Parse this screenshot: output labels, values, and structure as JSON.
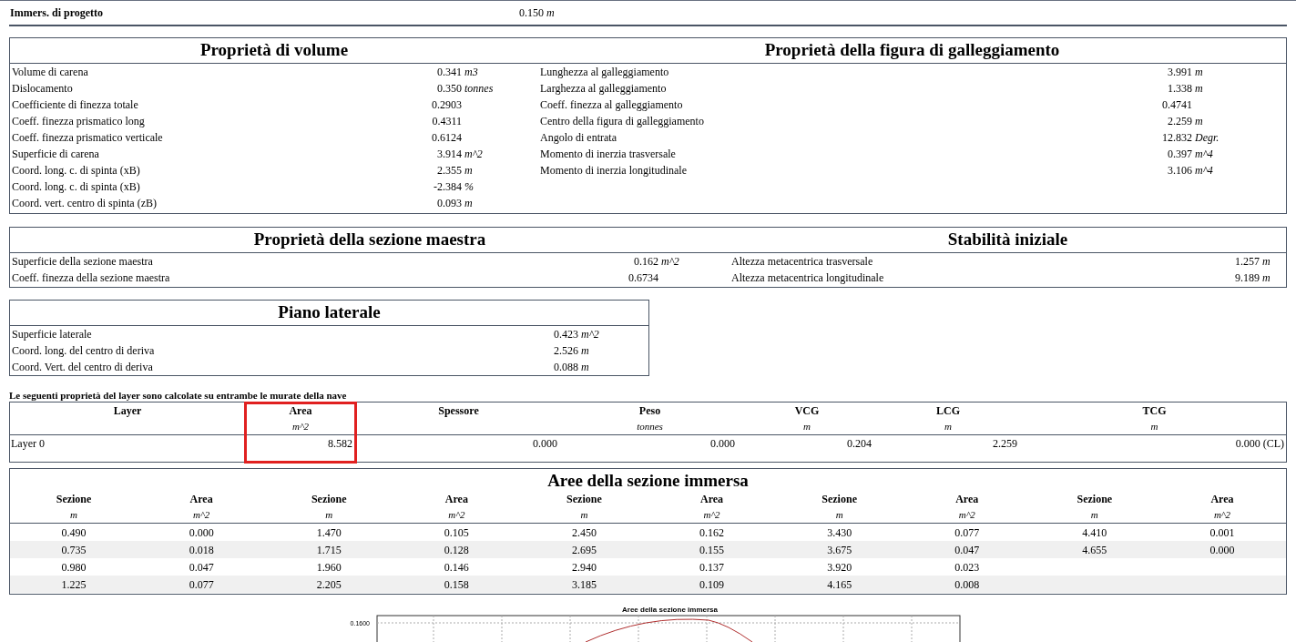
{
  "design_draft": {
    "label": "Immers. di progetto",
    "value": "0.150",
    "unit": "m"
  },
  "volume_properties": {
    "title": "Proprietà di volume",
    "rows": [
      {
        "label": "Volume di carena",
        "value": "0.341",
        "unit": "m3"
      },
      {
        "label": "Dislocamento",
        "value": "0.350",
        "unit": "tonnes"
      },
      {
        "label": "Coefficiente di finezza totale",
        "value": "0.2903"
      },
      {
        "label": "Coeff. finezza prismatico long",
        "value": "0.4311"
      },
      {
        "label": "Coeff. finezza prismatico verticale",
        "value": "0.6124"
      },
      {
        "label": "Superficie di carena",
        "value": "3.914",
        "unit": "m^2"
      },
      {
        "label": "Coord. long. c. di spinta (xB)",
        "value": "2.355",
        "unit": "m"
      },
      {
        "label": "Coord. long. c. di spinta (xB)",
        "value": "-2.384",
        "unit": "%"
      },
      {
        "label": "Coord. vert. centro di spinta (zB)",
        "value": "0.093",
        "unit": "m"
      }
    ]
  },
  "waterplane_properties": {
    "title": "Proprietà della figura di galleggiamento",
    "rows": [
      {
        "label": "Lunghezza al galleggiamento",
        "value": "3.991",
        "unit": "m"
      },
      {
        "label": "Larghezza al galleggiamento",
        "value": "1.338",
        "unit": "m"
      },
      {
        "label": "Coeff. finezza al galleggiamento",
        "value": "0.4741"
      },
      {
        "label": "Centro della figura di galleggiamento",
        "value": "2.259",
        "unit": "m"
      },
      {
        "label": "Angolo di entrata",
        "value": "12.832",
        "unit": "Degr."
      },
      {
        "label": "Momento di inerzia trasversale",
        "value": "0.397",
        "unit": "m^4"
      },
      {
        "label": "Momento di inerzia longitudinale",
        "value": "3.106",
        "unit": "m^4"
      }
    ]
  },
  "midship_section": {
    "title": "Proprietà della sezione maestra",
    "rows": [
      {
        "label": "Superficie della sezione maestra",
        "value": "0.162",
        "unit": "m^2"
      },
      {
        "label": "Coeff. finezza della sezione maestra",
        "value": "0.6734"
      }
    ]
  },
  "initial_stability": {
    "title": "Stabilità iniziale",
    "rows": [
      {
        "label": "Altezza metacentrica trasversale",
        "value": "1.257",
        "unit": "m"
      },
      {
        "label": "Altezza metacentrica longitudinale",
        "value": "9.189",
        "unit": "m"
      }
    ]
  },
  "lateral_plane": {
    "title": "Piano laterale",
    "rows": [
      {
        "label": "Superficie laterale",
        "value": "0.423",
        "unit": "m^2"
      },
      {
        "label": "Coord. long. del centro di deriva",
        "value": "2.526",
        "unit": "m"
      },
      {
        "label": "Coord. Vert. del centro di deriva",
        "value": "0.088",
        "unit": "m"
      }
    ]
  },
  "layer_note": "Le seguenti proprietà del layer sono calcolate su entrambe le murate della nave",
  "layer_table": {
    "columns": [
      {
        "heading": "Layer",
        "highlighted": false
      },
      {
        "heading": "Area",
        "unit": "m^2",
        "highlighted": true
      },
      {
        "heading": "Spessore",
        "highlighted": false
      },
      {
        "heading": "Peso",
        "unit": "tonnes",
        "highlighted": false
      },
      {
        "heading": "VCG",
        "unit": "m",
        "highlighted": false
      },
      {
        "heading": "LCG",
        "unit": "m",
        "highlighted": false
      },
      {
        "heading": "TCG",
        "unit": "m",
        "highlighted": false
      }
    ],
    "rows": [
      [
        "Layer 0",
        "8.582",
        "0.000",
        "0.000",
        "0.204",
        "2.259",
        "0.000 (CL)"
      ]
    ]
  },
  "immersed_areas": {
    "title": "Aree della sezione immersa",
    "columns": [
      {
        "heading": "Sezione",
        "unit": "m"
      },
      {
        "heading": "Area",
        "unit": "m^2"
      },
      {
        "heading": "Sezione",
        "unit": "m"
      },
      {
        "heading": "Area",
        "unit": "m^2"
      },
      {
        "heading": "Sezione",
        "unit": "m"
      },
      {
        "heading": "Area",
        "unit": "m^2"
      },
      {
        "heading": "Sezione",
        "unit": "m"
      },
      {
        "heading": "Area",
        "unit": "m^2"
      },
      {
        "heading": "Sezione",
        "unit": "m"
      },
      {
        "heading": "Area",
        "unit": "m^2"
      }
    ],
    "rows": [
      [
        "0.490",
        "0.000",
        "1.470",
        "0.105",
        "2.450",
        "0.162",
        "3.430",
        "0.077",
        "4.410",
        "0.001"
      ],
      [
        "0.735",
        "0.018",
        "1.715",
        "0.128",
        "2.695",
        "0.155",
        "3.675",
        "0.047",
        "4.655",
        "0.000"
      ],
      [
        "0.980",
        "0.047",
        "1.960",
        "0.146",
        "2.940",
        "0.137",
        "3.920",
        "0.023"
      ],
      [
        "1.225",
        "0.077",
        "2.205",
        "0.158",
        "3.185",
        "0.109",
        "4.165",
        "0.008"
      ]
    ]
  },
  "chart": {
    "title": "Aree della sezione immersa",
    "y_tick_label": "0.1600"
  }
}
